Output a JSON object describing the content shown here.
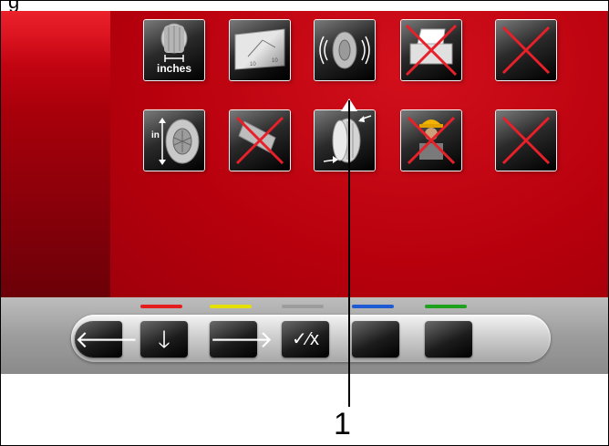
{
  "top_label": "g",
  "tiles": {
    "units": {
      "label": "inches",
      "icon": "tire-width-inches-icon"
    },
    "gauge": {
      "icon": "gauge-scale-icon"
    },
    "vibration": {
      "icon": "tire-vibration-icon"
    },
    "printer": {
      "icon": "printer-disabled-icon"
    },
    "empty_top": {
      "icon": "disabled-x-icon"
    },
    "rim": {
      "label": "in",
      "icon": "rim-diameter-inches-icon"
    },
    "tool": {
      "icon": "tool-disabled-icon"
    },
    "tire_profile": {
      "icon": "tire-profile-icon"
    },
    "operator": {
      "icon": "operator-disabled-icon"
    },
    "empty_bottom": {
      "icon": "disabled-x-icon"
    }
  },
  "toolbar": {
    "colors": [
      "#e41e1e",
      "#e6e000",
      "#9c9c9c",
      "#1e5ad2",
      "#1ea21e"
    ],
    "buttons": [
      {
        "icon": "arrow-left-icon",
        "glyph": "🡐"
      },
      {
        "icon": "arrow-down-icon",
        "glyph": "🡓"
      },
      {
        "icon": "arrow-right-icon",
        "glyph": "🡒"
      },
      {
        "icon": "toggle-check-x-icon",
        "glyph": "✓⁄x"
      },
      {
        "icon": "blank-button-icon",
        "glyph": ""
      },
      {
        "icon": "blank-button-icon",
        "glyph": ""
      }
    ]
  },
  "callout": {
    "number": "1"
  }
}
